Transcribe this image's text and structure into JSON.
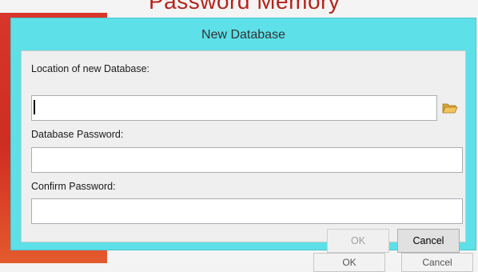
{
  "background": {
    "app_title": "Password Memory",
    "accent_color": "#cf2d22",
    "bottom_buttons": [
      "OK",
      "Cancel"
    ]
  },
  "dialog": {
    "title": "New Database",
    "title_bar_color": "#5de0e8",
    "location": {
      "label": "Location of new Database:",
      "value": "",
      "browse_icon": "folder-open-icon"
    },
    "password": {
      "label": "Database Password:",
      "value": ""
    },
    "confirm": {
      "label": "Confirm Password:",
      "value": ""
    },
    "ok_label": "OK",
    "ok_enabled": false,
    "cancel_label": "Cancel"
  }
}
